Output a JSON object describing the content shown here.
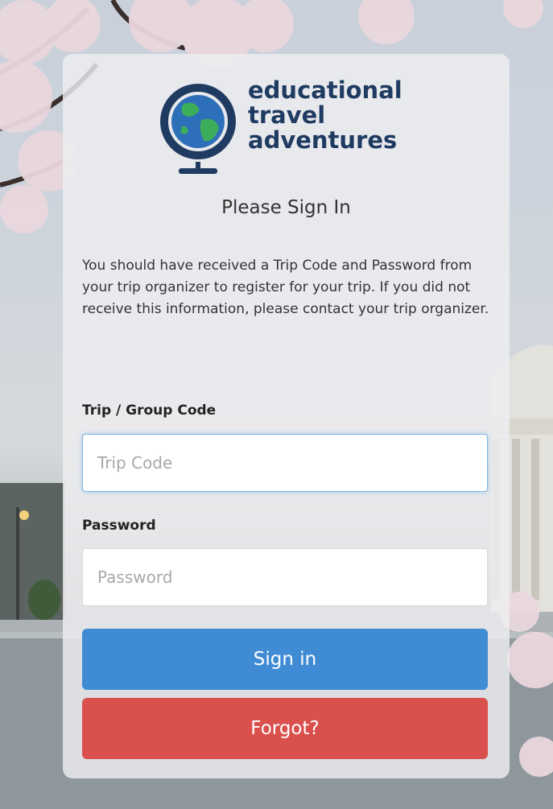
{
  "brand": {
    "line1": "educational",
    "line2": "travel",
    "line3": "adventures",
    "color": "#1f3b61",
    "globe_blue": "#2d6fb8",
    "globe_green": "#3cae5a"
  },
  "login": {
    "title": "Please Sign In",
    "intro": "You should have received a Trip Code and Password from your trip organizer to register for your trip. If you did not receive this information, please contact your trip organizer.",
    "trip_code_label": "Trip / Group Code",
    "trip_code_placeholder": "Trip Code",
    "password_label": "Password",
    "password_placeholder": "Password",
    "signin_label": "Sign in",
    "forgot_label": "Forgot?"
  },
  "colors": {
    "signin": "#3f8bd4",
    "forgot": "#d9504c"
  }
}
